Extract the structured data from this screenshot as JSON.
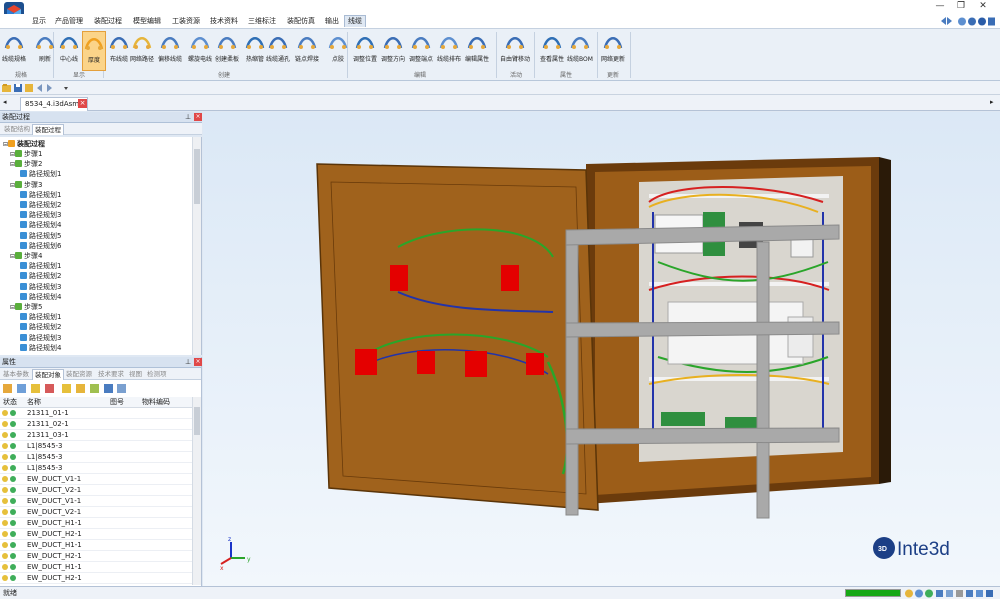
{
  "window": {
    "min_glyph": "—",
    "restore_glyph": "❐",
    "close_glyph": "✕"
  },
  "menu": [
    "显示",
    "产品管理",
    "装配过程",
    "模型编辑",
    "工装资源",
    "技术资料",
    "三维标注",
    "装配仿真",
    "输出",
    "线缆"
  ],
  "ribbon": {
    "buttons": [
      "线缆规格",
      "刷新",
      "中心线",
      "厚度",
      "布线缆",
      "网络路径",
      "偏移线缆",
      "螺旋电线",
      "创建柔板",
      "热缩管",
      "线缆通孔",
      "链点焊接",
      "点胶",
      "调整位置",
      "调整方向",
      "调整端点",
      "线缆排布",
      "编辑属性",
      "自由臂移动",
      "查看属性",
      "线缆BOM",
      "网络更新"
    ],
    "groups": [
      "规格",
      "显示",
      "创建",
      "编辑",
      "活动",
      "属性",
      "更新"
    ]
  },
  "document": {
    "tab_title": "8534_4.i3dAsm"
  },
  "assembly_panel": {
    "title": "装配过程",
    "tabs": [
      "装配结构",
      "装配过程"
    ],
    "root": "装配过程",
    "tree": [
      {
        "label": "步骤1",
        "level": 1
      },
      {
        "label": "步骤2",
        "level": 1
      },
      {
        "label": "路径规划1",
        "level": 2
      },
      {
        "label": "步骤3",
        "level": 1
      },
      {
        "label": "路径规划1",
        "level": 2
      },
      {
        "label": "路径规划2",
        "level": 2
      },
      {
        "label": "路径规划3",
        "level": 2
      },
      {
        "label": "路径规划4",
        "level": 2
      },
      {
        "label": "路径规划5",
        "level": 2
      },
      {
        "label": "路径规划6",
        "level": 2
      },
      {
        "label": "步骤4",
        "level": 1
      },
      {
        "label": "路径规划1",
        "level": 2
      },
      {
        "label": "路径规划2",
        "level": 2
      },
      {
        "label": "路径规划3",
        "level": 2
      },
      {
        "label": "路径规划4",
        "level": 2
      },
      {
        "label": "步骤5",
        "level": 1
      },
      {
        "label": "路径规划1",
        "level": 2
      },
      {
        "label": "路径规划2",
        "level": 2
      },
      {
        "label": "路径规划3",
        "level": 2
      },
      {
        "label": "路径规划4",
        "level": 2
      }
    ]
  },
  "properties_panel": {
    "title": "属性",
    "tabs": [
      "基本参数",
      "装配对象",
      "装配资源",
      "技术要求",
      "视图",
      "检测项"
    ],
    "columns": [
      "状态",
      "名称",
      "图号",
      "物料编码"
    ],
    "rows": [
      "21311_01-1",
      "21311_02-1",
      "21311_03-1",
      "L1|8545-3",
      "L1|8545-3",
      "L1|8545-3",
      "EW_DUCT_V1-1",
      "EW_DUCT_V2-1",
      "EW_DUCT_V1-1",
      "EW_DUCT_V2-1",
      "EW_DUCT_H1-1",
      "EW_DUCT_H2-1",
      "EW_DUCT_H1-1",
      "EW_DUCT_H2-1",
      "EW_DUCT_H1-1",
      "EW_DUCT_H2-1"
    ]
  },
  "viewport": {
    "logo_text": "Inte3d",
    "logo_badge": "3D",
    "axis_labels": [
      "x",
      "y",
      "z"
    ]
  },
  "status": {
    "text": "就绪",
    "progress": 1.0
  },
  "colors": {
    "accent": "#2f6fb5",
    "cabinet": "#8a4f12",
    "door": "#a0621c",
    "wire_green": "#2aa52a",
    "wire_blue": "#2233aa",
    "wire_red": "#d62020",
    "component_red": "#e40000",
    "progress": "#16a816"
  }
}
